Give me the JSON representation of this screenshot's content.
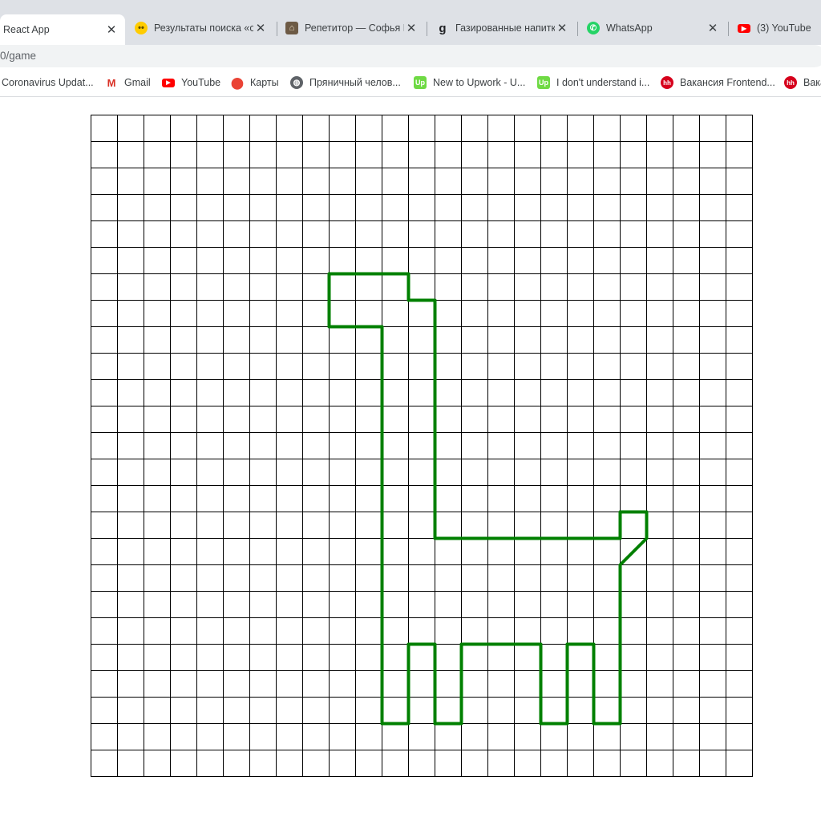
{
  "tabs": [
    {
      "title": "React App",
      "favicon": "react-icon",
      "active": true
    },
    {
      "title": "Результаты поиска «с",
      "favicon": "yandex-smile-icon",
      "active": false
    },
    {
      "title": "Репетитор — Софья В",
      "favicon": "tutor-photo-icon",
      "active": false
    },
    {
      "title": "Газированные напитк",
      "favicon": "g-letter-icon",
      "active": false
    },
    {
      "title": "WhatsApp",
      "favicon": "whatsapp-icon",
      "active": false
    },
    {
      "title": "(3) YouTube",
      "favicon": "youtube-icon",
      "active": false
    }
  ],
  "close_glyph": "✕",
  "address_bar": {
    "url": "0/game"
  },
  "bookmarks": [
    {
      "label": "Coronavirus Updat...",
      "icon": "none"
    },
    {
      "label": "Gmail",
      "icon": "gmail-icon"
    },
    {
      "label": "YouTube",
      "icon": "youtube-icon"
    },
    {
      "label": "Карты",
      "icon": "maps-pin-icon"
    },
    {
      "label": "Пряничный челов...",
      "icon": "globe-icon"
    },
    {
      "label": "New to Upwork - U...",
      "icon": "upwork-icon"
    },
    {
      "label": "I don't understand i...",
      "icon": "upwork-icon"
    },
    {
      "label": "Вакансия Frontend...",
      "icon": "hh-icon"
    },
    {
      "label": "Вака",
      "icon": "hh-icon"
    }
  ],
  "game": {
    "grid_cols": 25,
    "grid_rows": 25,
    "path_color": "#008000",
    "grid_color": "#000000",
    "path_cells": [
      [
        9,
        6
      ],
      [
        10,
        6
      ],
      [
        11,
        6
      ],
      [
        12,
        6
      ],
      [
        12,
        7
      ],
      [
        13,
        7
      ],
      [
        13,
        8
      ],
      [
        13,
        9
      ],
      [
        13,
        10
      ],
      [
        13,
        11
      ],
      [
        13,
        12
      ],
      [
        13,
        13
      ],
      [
        13,
        14
      ],
      [
        13,
        15
      ],
      [
        13,
        16
      ],
      [
        14,
        16
      ],
      [
        15,
        16
      ],
      [
        16,
        16
      ],
      [
        17,
        16
      ],
      [
        18,
        16
      ],
      [
        19,
        16
      ],
      [
        20,
        16
      ],
      [
        20,
        15
      ],
      [
        21,
        15
      ],
      [
        21,
        16
      ],
      [
        20,
        17
      ],
      [
        20,
        18
      ],
      [
        20,
        19
      ],
      [
        20,
        20
      ],
      [
        20,
        21
      ],
      [
        20,
        22
      ],
      [
        20,
        23
      ],
      [
        19,
        23
      ],
      [
        19,
        22
      ],
      [
        19,
        21
      ],
      [
        19,
        20
      ],
      [
        18,
        20
      ],
      [
        18,
        21
      ],
      [
        18,
        22
      ],
      [
        18,
        23
      ],
      [
        17,
        23
      ],
      [
        17,
        22
      ],
      [
        17,
        21
      ],
      [
        17,
        20
      ],
      [
        16,
        20
      ],
      [
        15,
        20
      ],
      [
        14,
        20
      ],
      [
        14,
        21
      ],
      [
        14,
        22
      ],
      [
        14,
        23
      ],
      [
        13,
        23
      ],
      [
        13,
        22
      ],
      [
        13,
        21
      ],
      [
        13,
        20
      ],
      [
        12,
        20
      ],
      [
        12,
        21
      ],
      [
        12,
        22
      ],
      [
        12,
        23
      ],
      [
        11,
        23
      ],
      [
        11,
        22
      ],
      [
        11,
        21
      ],
      [
        11,
        20
      ],
      [
        11,
        19
      ],
      [
        11,
        18
      ],
      [
        11,
        17
      ],
      [
        11,
        16
      ],
      [
        11,
        15
      ],
      [
        11,
        14
      ],
      [
        11,
        13
      ],
      [
        11,
        12
      ],
      [
        11,
        11
      ],
      [
        11,
        10
      ],
      [
        11,
        9
      ],
      [
        11,
        8
      ],
      [
        10,
        8
      ],
      [
        9,
        8
      ],
      [
        9,
        7
      ]
    ]
  }
}
